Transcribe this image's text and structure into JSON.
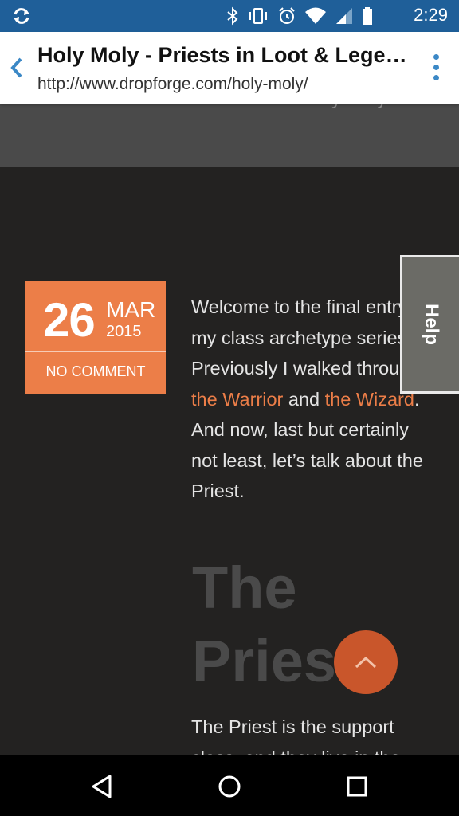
{
  "status_bar": {
    "time": "2:29",
    "icons": [
      "sync-icon",
      "bluetooth-icon",
      "vibrate-icon",
      "alarm-icon",
      "wifi-icon",
      "signal-icon",
      "battery-icon"
    ]
  },
  "toolbar": {
    "title": "Holy Moly - Priests in Loot & Legen...",
    "url": "http://www.dropforge.com/holy-moly/"
  },
  "breadcrumb": [
    "Home",
    "Dev Diaries",
    "Holy Moly"
  ],
  "post": {
    "day": "26",
    "month": "MAR",
    "year": "2015",
    "comment_label": "NO COMMENT",
    "intro_1": "Welcome to the final entry in my class archetype series! Previously I walked through ",
    "link_warrior": "the Warrior",
    "intro_2": " and ",
    "link_wizard": "the Wizard",
    "intro_3": ". And now, last but certainly not least, let’s talk about the Priest.",
    "heading": "The Priest",
    "para2": "The Priest is the support class, and they live in the"
  },
  "help_label": "Help",
  "colors": {
    "status_bar": "#1f5f99",
    "accent": "#ec7e48",
    "page_bg": "#232221",
    "header_band": "#4a4a4a",
    "scroll_button": "#c9562b"
  }
}
